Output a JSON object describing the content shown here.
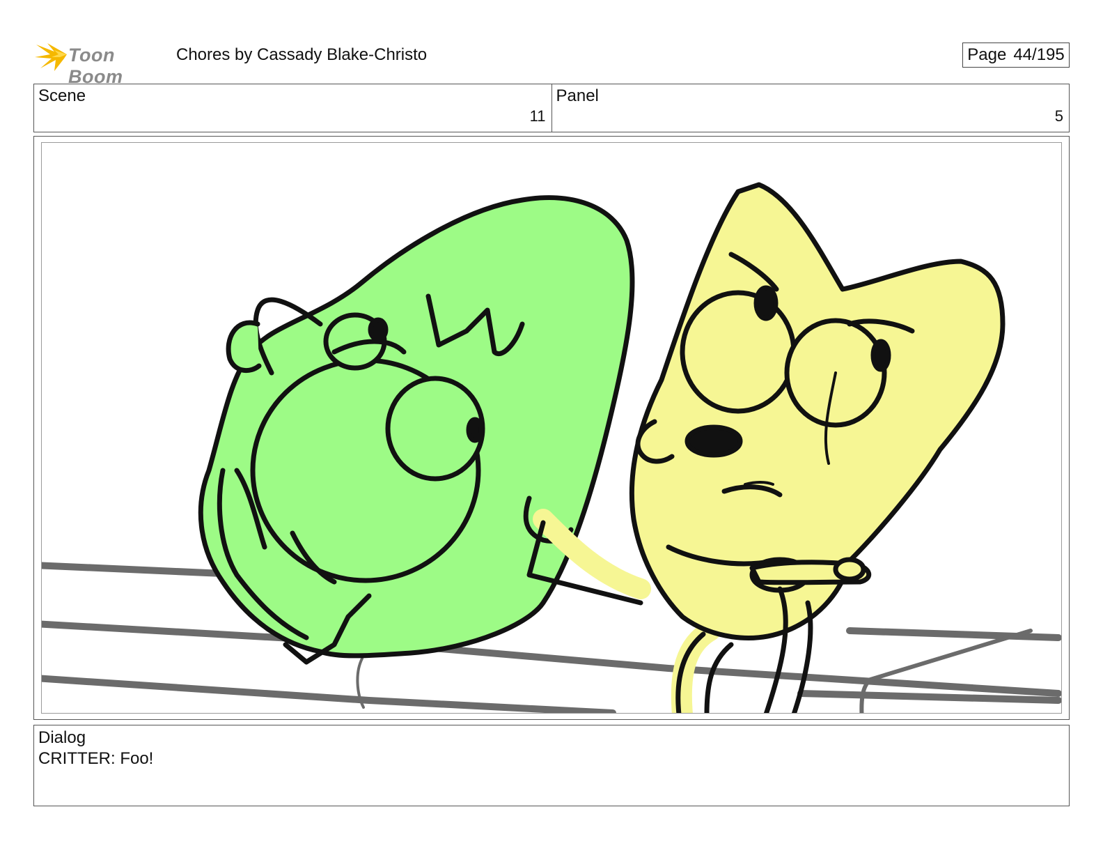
{
  "header": {
    "logo_text": "Toon Boom",
    "title": "Chores  by Cassady Blake-Christo",
    "page_label": "Page",
    "page_number": "44/195"
  },
  "info": {
    "scene_label": "Scene",
    "scene_value": "11",
    "panel_label": "Panel",
    "panel_value": "5"
  },
  "dialog": {
    "label": "Dialog",
    "text": "CRITTER: Foo!"
  },
  "colors": {
    "green_character": "#9dfb86",
    "yellow_character": "#f6f694",
    "line": "#111111",
    "rail": "#6b6b6b",
    "logo_accent": "#f5b800"
  }
}
